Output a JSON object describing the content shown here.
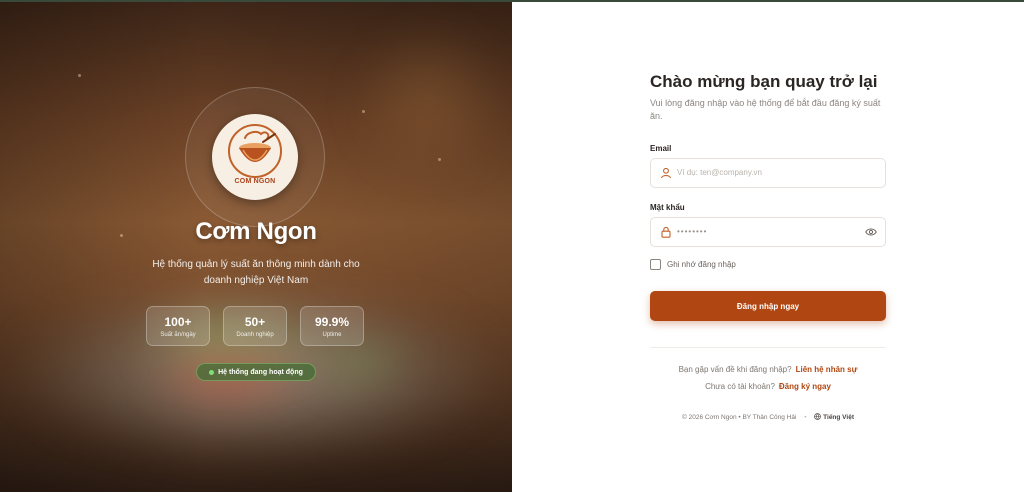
{
  "hero": {
    "logo_text": "COM NGON",
    "brand": "Cơm Ngon",
    "tagline": "Hệ thống quản lý suất ăn thông minh dành cho doanh nghiệp Việt Nam",
    "stats": [
      {
        "value": "100+",
        "label": "Suất ăn/ngày"
      },
      {
        "value": "50+",
        "label": "Doanh nghiệp"
      },
      {
        "value": "99.9%",
        "label": "Uptime"
      }
    ],
    "status": "Hệ thống đang hoạt động"
  },
  "login": {
    "title": "Chào mừng bạn quay trở lại",
    "subtitle": "Vui lòng đăng nhập vào hệ thống để bắt đầu đăng ký suất ăn.",
    "email_label": "Email",
    "email_placeholder": "Ví dụ: ten@company.vn",
    "password_label": "Mật khẩu",
    "password_value": "••••••••",
    "remember_label": "Ghi nhớ đăng nhập",
    "submit_label": "Đăng nhập ngay",
    "help_text": "Bạn gặp vấn đề khi đăng nhập?",
    "help_link": "Liên hệ nhân sự",
    "signup_text": "Chưa có tài khoản?",
    "signup_link": "Đăng ký ngay"
  },
  "footer": {
    "copyright": "© 2026 Cơm Ngon • BY Thân Công Hải",
    "language": "Tiếng Việt"
  },
  "colors": {
    "accent": "#b04712",
    "status_green": "#7ee07a"
  }
}
